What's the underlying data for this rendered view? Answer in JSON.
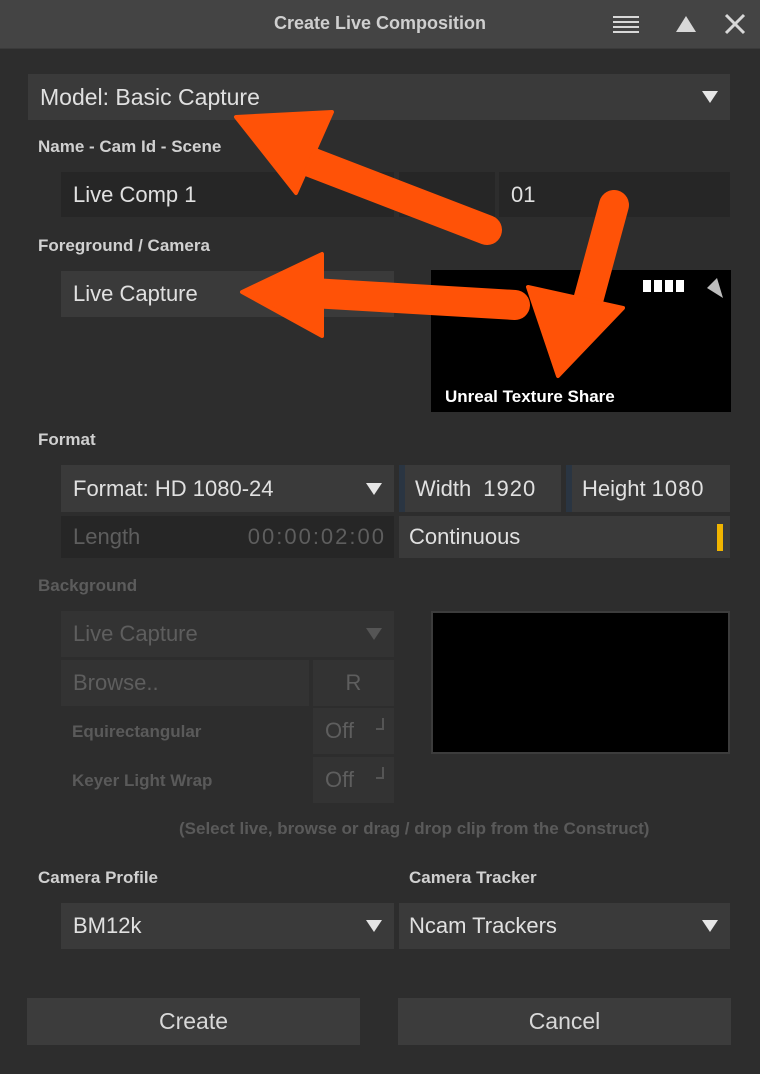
{
  "window": {
    "title": "Create Live Composition"
  },
  "model_select": {
    "label": "Model: Basic Capture"
  },
  "name_section": {
    "label": "Name - Cam Id - Scene",
    "name_value": "Live Comp 1",
    "cam_id": "",
    "scene": "01"
  },
  "foreground": {
    "label": "Foreground / Camera",
    "source": "Live Capture",
    "preview_caption": "Unreal Texture Share"
  },
  "format": {
    "label": "Format",
    "format_select": "Format: HD 1080-24",
    "width_label": "Width",
    "width_value": "1920",
    "height_label": "Height",
    "height_value": "1080",
    "length_label": "Length",
    "length_value": "00:00:02:00",
    "mode": "Continuous"
  },
  "background": {
    "label": "Background",
    "source": "Live Capture",
    "browse": "Browse..",
    "reset": "R",
    "equirect_label": "Equirectangular",
    "equirect_value": "Off",
    "lightwrap_label": "Keyer Light Wrap",
    "lightwrap_value": "Off",
    "hint": "(Select live, browse or drag / drop clip from the Construct)"
  },
  "camera_profile": {
    "label": "Camera Profile",
    "value": "BM12k"
  },
  "camera_tracker": {
    "label": "Camera Tracker",
    "value": "Ncam Trackers"
  },
  "actions": {
    "create": "Create",
    "cancel": "Cancel"
  },
  "colors": {
    "arrow": "#ff5207",
    "accent": "#f0b400"
  }
}
